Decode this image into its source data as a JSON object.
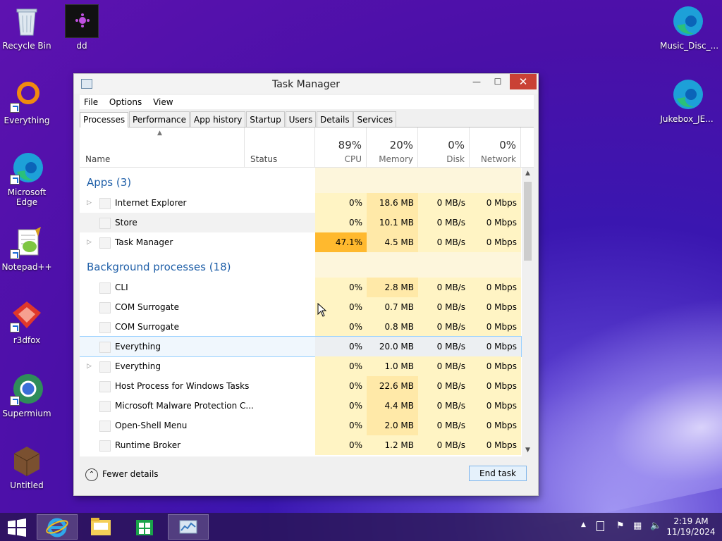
{
  "desktop": {
    "icons": [
      {
        "label": "Recycle Bin"
      },
      {
        "label": "dd"
      },
      {
        "label": "Everything"
      },
      {
        "label": "Microsoft Edge"
      },
      {
        "label": "Notepad++"
      },
      {
        "label": "r3dfox"
      },
      {
        "label": "Supermium"
      },
      {
        "label": "Untitled"
      },
      {
        "label": "Music_Disc_..."
      },
      {
        "label": "Jukebox_JE..."
      }
    ]
  },
  "window": {
    "title": "Task Manager",
    "menu": [
      "File",
      "Options",
      "View"
    ],
    "tabs": [
      "Processes",
      "Performance",
      "App history",
      "Startup",
      "Users",
      "Details",
      "Services"
    ],
    "active_tab": "Processes",
    "columns": {
      "name": "Name",
      "status": "Status",
      "cpu": {
        "pct": "89%",
        "label": "CPU"
      },
      "memory": {
        "pct": "20%",
        "label": "Memory"
      },
      "disk": {
        "pct": "0%",
        "label": "Disk"
      },
      "network": {
        "pct": "0%",
        "label": "Network"
      }
    },
    "groups": [
      {
        "title": "Apps (3)",
        "rows": [
          {
            "name": "Internet Explorer",
            "expandable": true,
            "cpu": "0%",
            "mem": "18.6 MB",
            "disk": "0 MB/s",
            "net": "0 Mbps"
          },
          {
            "name": "Store",
            "expandable": false,
            "cpu": "0%",
            "mem": "10.1 MB",
            "disk": "0 MB/s",
            "net": "0 Mbps"
          },
          {
            "name": "Task Manager",
            "expandable": true,
            "cpu": "47.1%",
            "mem": "4.5 MB",
            "disk": "0 MB/s",
            "net": "0 Mbps"
          }
        ]
      },
      {
        "title": "Background processes (18)",
        "rows": [
          {
            "name": "CLI",
            "expandable": false,
            "cpu": "0%",
            "mem": "2.8 MB",
            "disk": "0 MB/s",
            "net": "0 Mbps"
          },
          {
            "name": "COM Surrogate",
            "expandable": false,
            "cpu": "0%",
            "mem": "0.7 MB",
            "disk": "0 MB/s",
            "net": "0 Mbps"
          },
          {
            "name": "COM Surrogate",
            "expandable": false,
            "cpu": "0%",
            "mem": "0.8 MB",
            "disk": "0 MB/s",
            "net": "0 Mbps"
          },
          {
            "name": "Everything",
            "expandable": false,
            "cpu": "0%",
            "mem": "20.0 MB",
            "disk": "0 MB/s",
            "net": "0 Mbps"
          },
          {
            "name": "Everything",
            "expandable": true,
            "cpu": "0%",
            "mem": "1.0 MB",
            "disk": "0 MB/s",
            "net": "0 Mbps"
          },
          {
            "name": "Host Process for Windows Tasks",
            "expandable": false,
            "cpu": "0%",
            "mem": "22.6 MB",
            "disk": "0 MB/s",
            "net": "0 Mbps"
          },
          {
            "name": "Microsoft Malware Protection C...",
            "expandable": false,
            "cpu": "0%",
            "mem": "4.4 MB",
            "disk": "0 MB/s",
            "net": "0 Mbps"
          },
          {
            "name": "Open-Shell Menu",
            "expandable": false,
            "cpu": "0%",
            "mem": "2.0 MB",
            "disk": "0 MB/s",
            "net": "0 Mbps"
          },
          {
            "name": "Runtime Broker",
            "expandable": false,
            "cpu": "0%",
            "mem": "1.2 MB",
            "disk": "0 MB/s",
            "net": "0 Mbps"
          }
        ]
      }
    ],
    "footer": {
      "fewer_details": "Fewer details",
      "end_task": "End task"
    }
  },
  "taskbar": {
    "items": [
      "start-button",
      "internet-explorer",
      "file-explorer",
      "store",
      "task-manager"
    ],
    "clock": {
      "time": "2:19 AM",
      "date": "11/19/2024"
    }
  },
  "colors": {
    "accent_group": "#1f5fa8",
    "close": "#c94135",
    "cpu_hot": "#ffb92e"
  }
}
